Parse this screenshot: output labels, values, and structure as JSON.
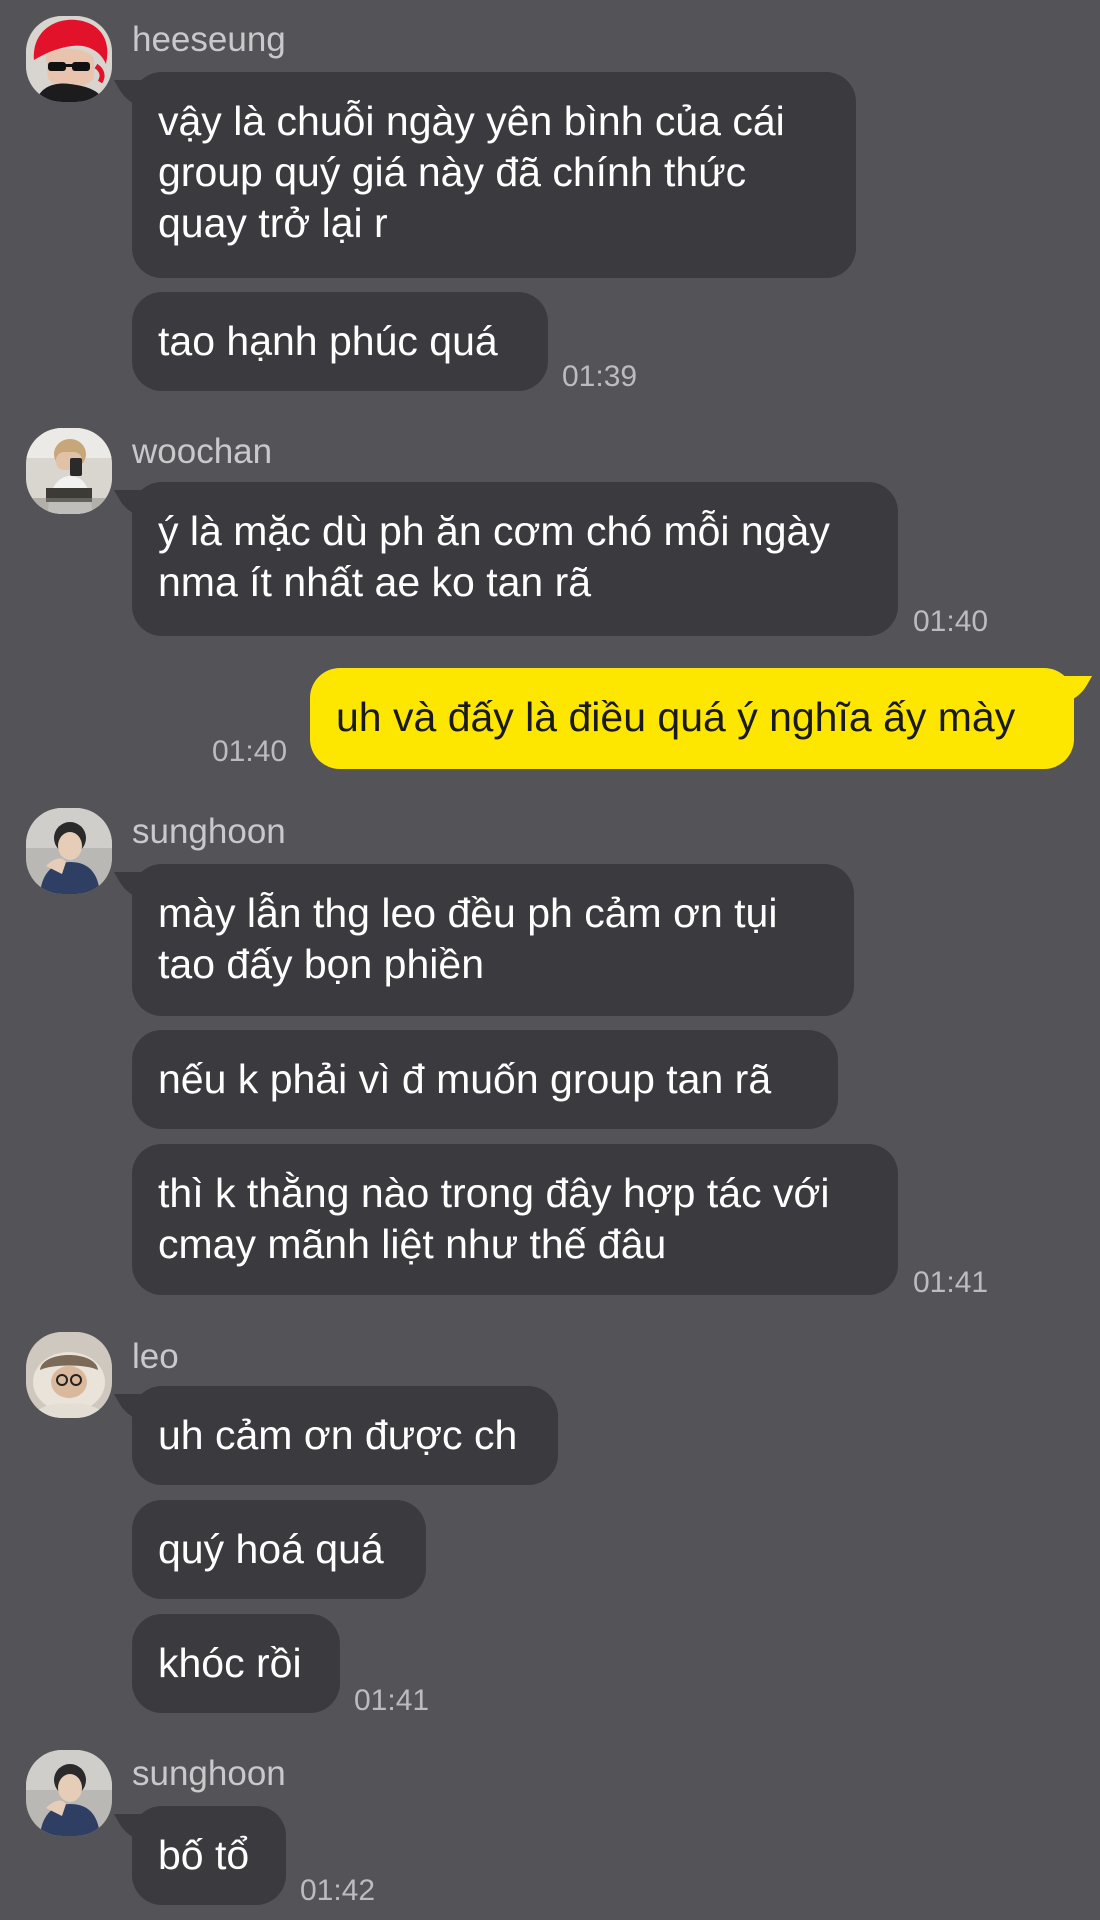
{
  "colors": {
    "background": "#545357",
    "incoming_bubble": "#3b3a3e",
    "outgoing_bubble": "#fde700",
    "timestamp": "#bcbcc0",
    "sender_name": "#c9c9cc"
  },
  "groups": [
    {
      "sender": "heeseung",
      "avatar_icon": "red-hair-avatar-icon",
      "messages": [
        {
          "lines": [
            "vậy là chuỗi ngày yên bình của cái",
            "group quý giá này đã chính thức",
            "quay trở lại r"
          ]
        },
        {
          "lines": [
            "tao hạnh phúc quá"
          ]
        }
      ],
      "time": "01:39"
    },
    {
      "sender": "woochan",
      "avatar_icon": "mirror-selfie-avatar-icon",
      "messages": [
        {
          "lines": [
            "ý là mặc dù ph ăn cơm chó mỗi ngày",
            "nma ít nhất ae ko tan rã"
          ]
        }
      ],
      "time": "01:40"
    },
    {
      "sender": "",
      "outgoing": true,
      "messages": [
        {
          "lines": [
            "uh và đấy là điều quá ý nghĩa ấy mày"
          ]
        }
      ],
      "time": "01:40"
    },
    {
      "sender": "sunghoon",
      "avatar_icon": "portrait-avatar-icon",
      "messages": [
        {
          "lines": [
            "mày lẫn thg leo đều ph cảm ơn tụi",
            "tao đấy bọn phiền"
          ]
        },
        {
          "lines": [
            "nếu k phải vì đ muốn group tan rã"
          ]
        },
        {
          "lines": [
            "thì k thằng nào trong đây hợp tác với",
            "cmay mãnh liệt như thế đâu"
          ]
        }
      ],
      "time": "01:41"
    },
    {
      "sender": "leo",
      "avatar_icon": "bucket-hat-avatar-icon",
      "messages": [
        {
          "lines": [
            "uh cảm ơn được ch"
          ]
        },
        {
          "lines": [
            "quý hoá quá"
          ]
        },
        {
          "lines": [
            "khóc rồi"
          ]
        }
      ],
      "time": "01:41"
    },
    {
      "sender": "sunghoon",
      "avatar_icon": "portrait-avatar-icon",
      "messages": [
        {
          "lines": [
            "bố tổ"
          ]
        }
      ],
      "time": "01:42"
    }
  ]
}
